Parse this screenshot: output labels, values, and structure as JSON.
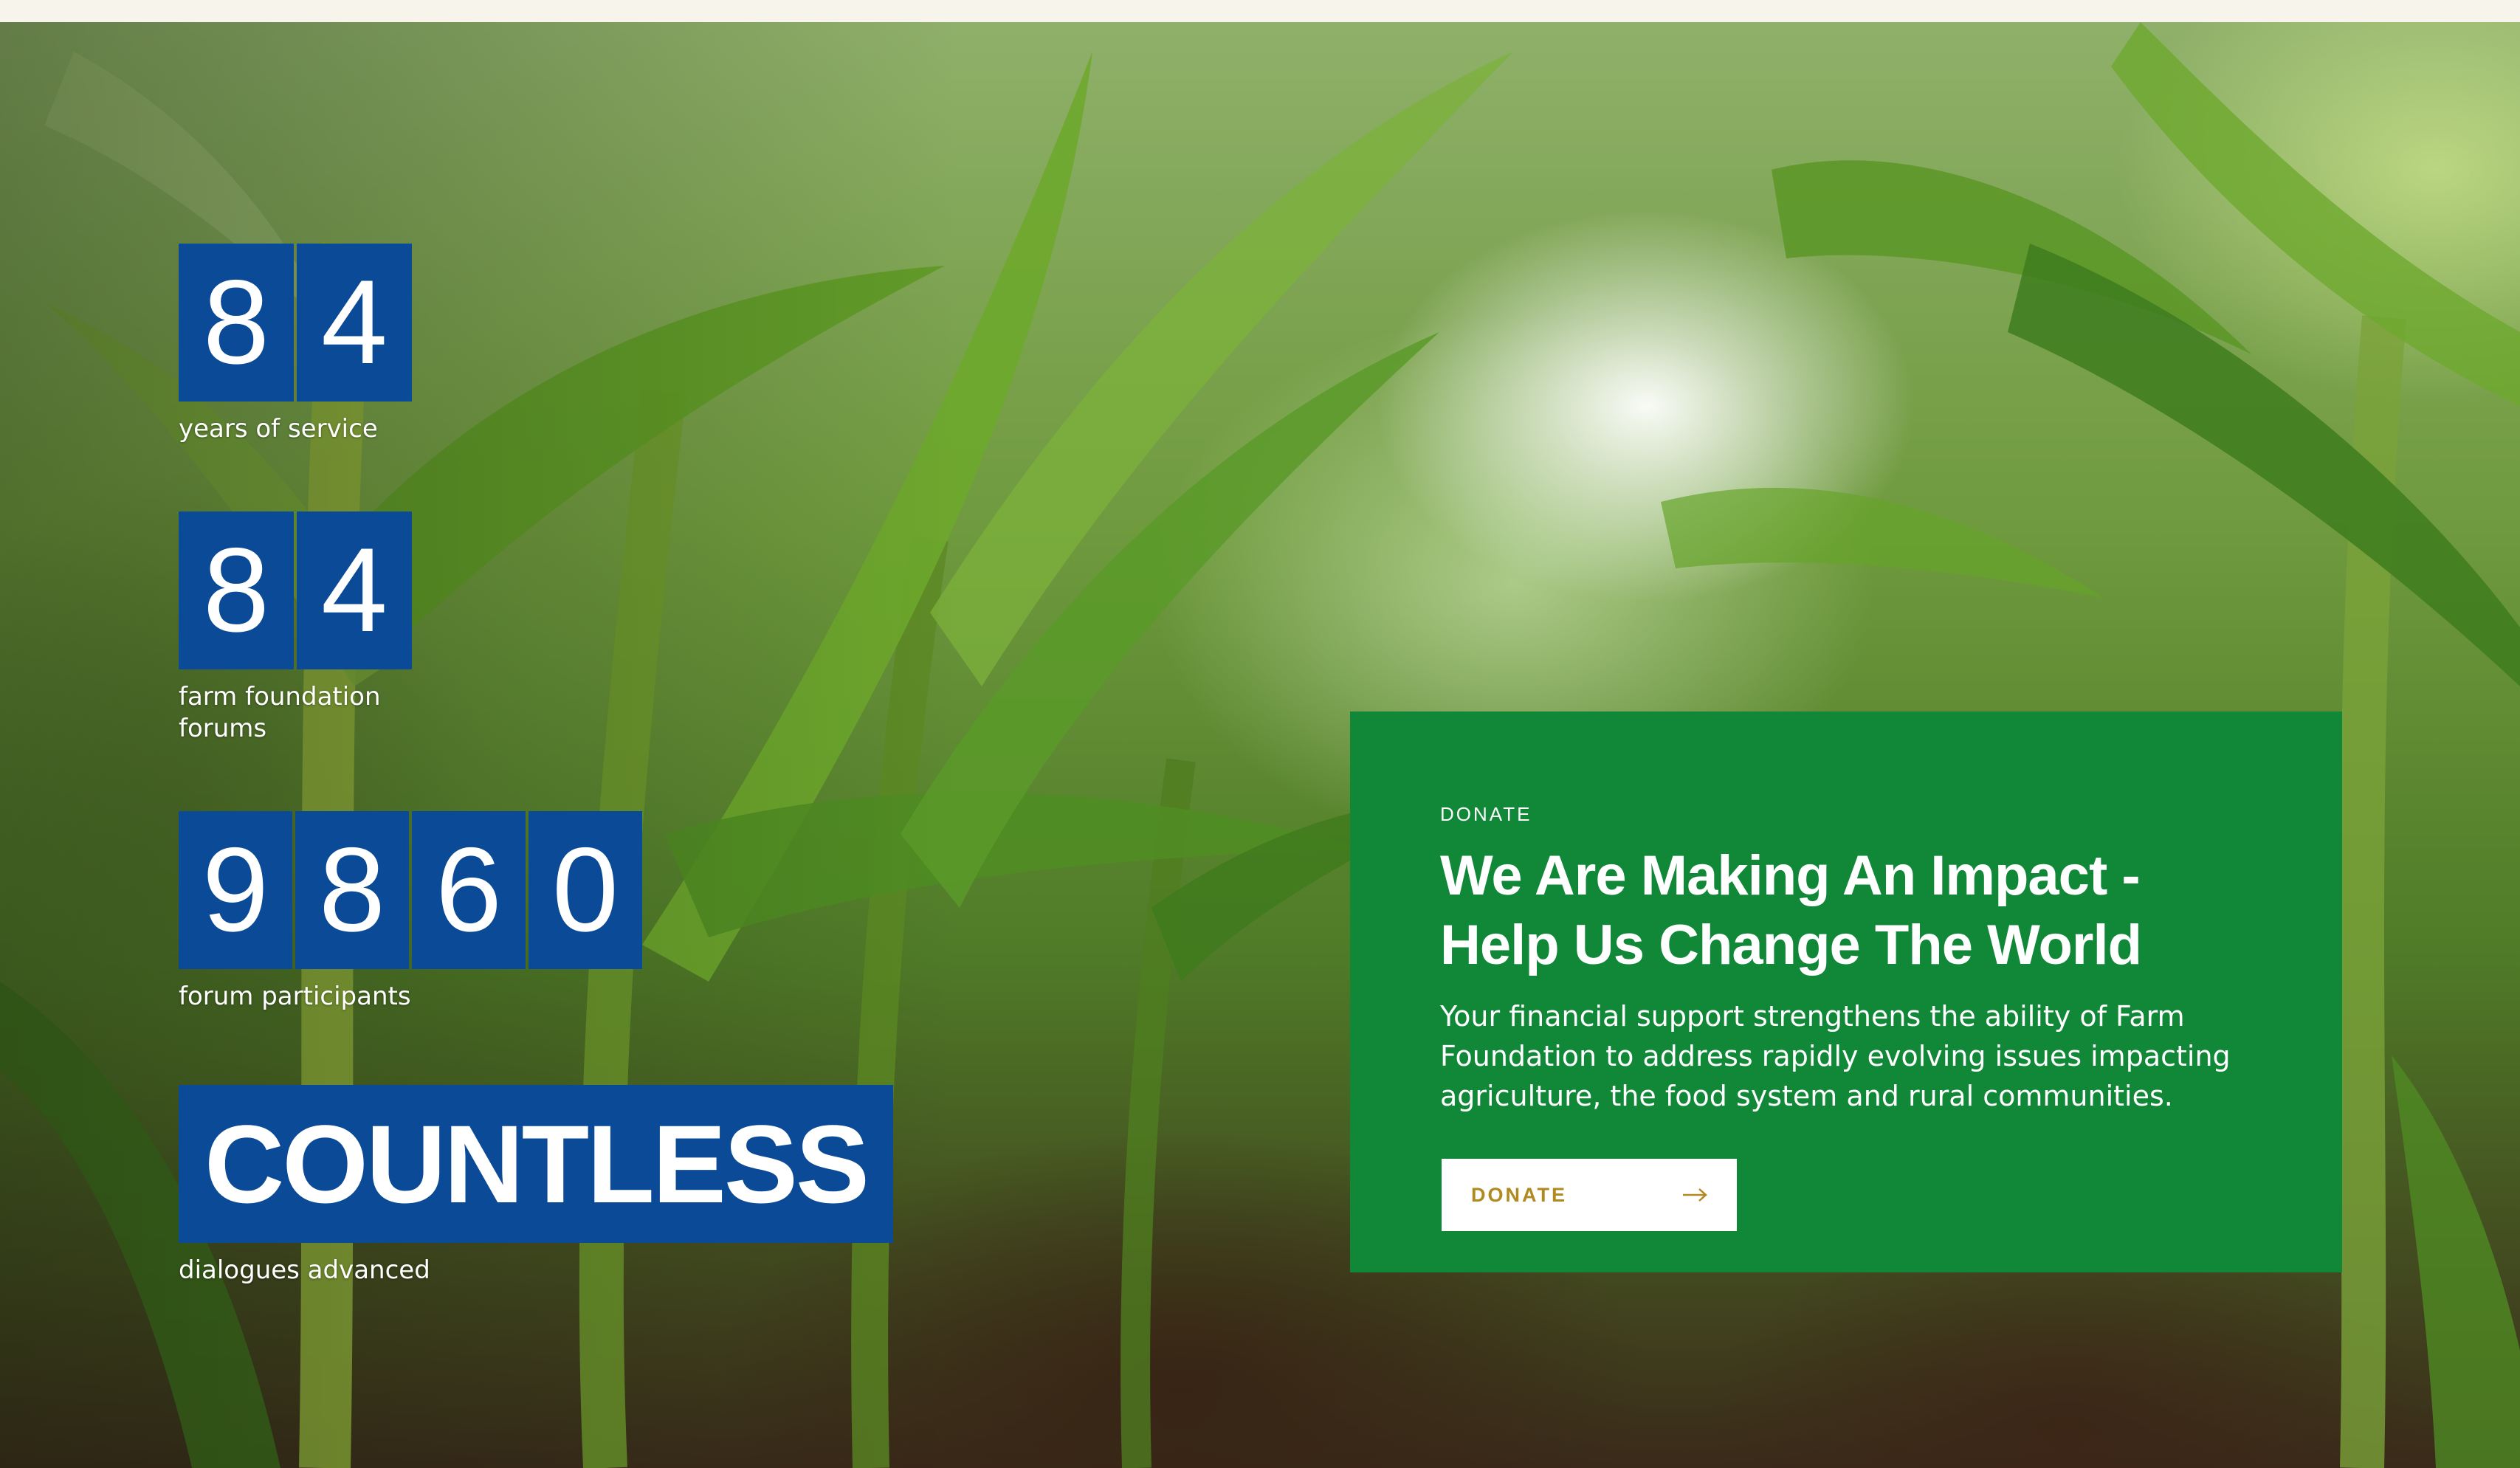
{
  "stats": [
    {
      "digits": [
        "8",
        "4"
      ],
      "label": "years of service"
    },
    {
      "digits": [
        "8",
        "4"
      ],
      "label": "farm foundation forums"
    },
    {
      "digits": [
        "9",
        "8",
        "6",
        "0"
      ],
      "label": "forum participants"
    },
    {
      "word": "COUNTLESS",
      "label": "dialogues advanced"
    }
  ],
  "donate_card": {
    "eyebrow": "DONATE",
    "title": "We Are Making An Impact - Help Us Change The World",
    "body": "Your financial support strengthens the ability of Farm Foundation to address rapidly evolving issues impacting agriculture, the food system and rural communities.",
    "button_label": "DONATE",
    "button_icon": "arrow-right-icon"
  },
  "colors": {
    "stat_tile": "#0b4a97",
    "card_background": "#108838",
    "button_text": "#b08a1f",
    "top_strip": "#f7f4ec"
  },
  "background_image": "corn-field-photo"
}
